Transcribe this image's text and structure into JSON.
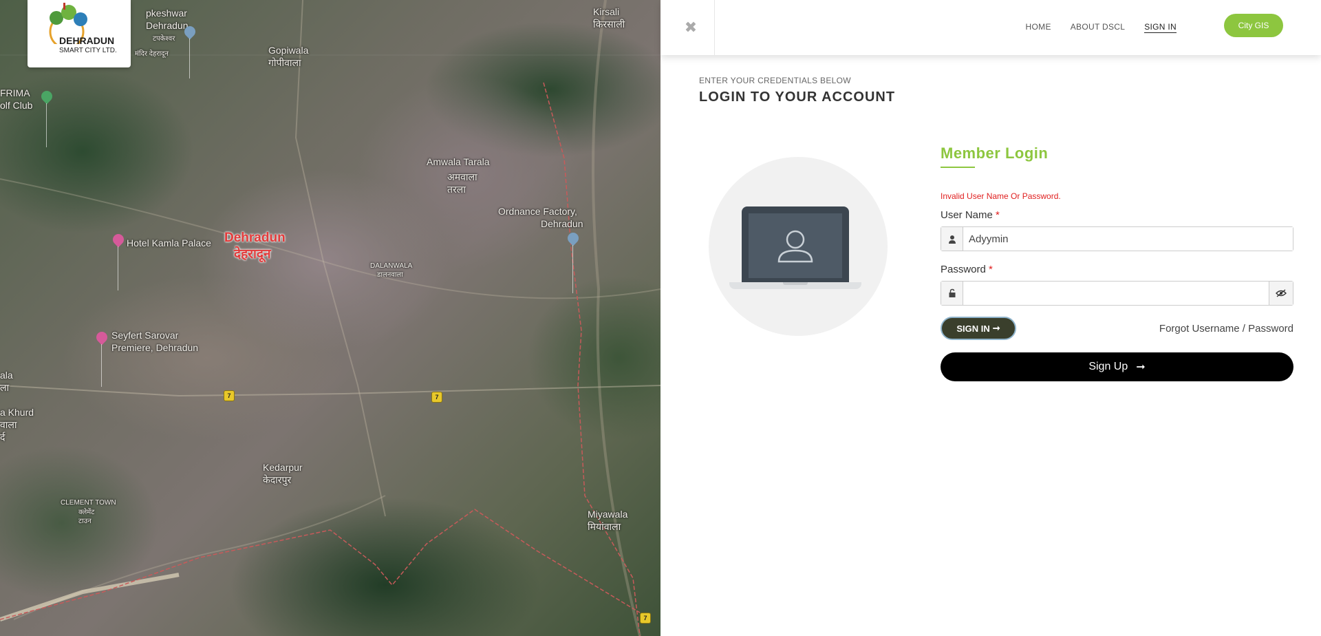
{
  "map": {
    "labels": {
      "kapkeshwar": "pkeshwar",
      "kapkeshwar2": "Dehradun",
      "kapkeshwar_hi": "टपकेश्वर",
      "kapkeshwar_hi2": "मंदिर देहरादून",
      "gopiwala": "Gopiwala",
      "gopiwala_hi": "गोपीवाला",
      "kirsali": "Kirsali",
      "kirsali_hi": "किरसाली",
      "frima": "FRIMA",
      "frima2": "olf Club",
      "amwala": "Amwala Tarala",
      "amwala_hi": "अमवाला",
      "amwala_hi2": "तरला",
      "ordnance": "Ordnance Factory,",
      "ordnance2": "Dehradun",
      "hotel": "Hotel Kamla Palace",
      "dehradun": "Dehradun",
      "dehradun_hi": "देहरादून",
      "dalanwala": "DALANWALA",
      "dalanwala_hi": "डालनवाला",
      "seyfert": "Seyfert Sarovar",
      "seyfert2": "Premiere, Dehradun",
      "ala": "ala",
      "ala_hi": "ला",
      "khurd": "a Khurd",
      "khurd_hi": "वाला",
      "khurd_hi2": "र्द",
      "kedarpur": "Kedarpur",
      "kedarpur_hi": "केदारपुर",
      "clement": "CLEMENT TOWN",
      "clement_hi": "क्लेमेंट",
      "clement_hi2": "टाउन",
      "miyawala": "Miyawala",
      "miyawala_hi": "मियांवाला"
    },
    "highway": "7"
  },
  "logo": {
    "title": "DEHRADUN",
    "subtitle": "SMART CITY LTD."
  },
  "nav": {
    "close_icon": "✖",
    "items": [
      {
        "label": "HOME"
      },
      {
        "label": "ABOUT DSCL"
      },
      {
        "label": "SIGN IN"
      }
    ],
    "city_gis": "City GIS"
  },
  "header": {
    "subtitle": "ENTER YOUR CREDENTIALS BELOW",
    "title": "LOGIN TO YOUR ACCOUNT"
  },
  "form": {
    "title": "Member Login",
    "error": "Invalid User Name Or Password.",
    "username_label": "User Name",
    "username_value": "Adyymin",
    "password_label": "Password",
    "password_value": "",
    "required_mark": "*",
    "signin_label": "SIGN IN",
    "signin_arrow": "➞",
    "forgot_label": "Forgot Username / Password",
    "signup_label": "Sign Up",
    "signup_arrow": "➞"
  },
  "colors": {
    "accent_green": "#8dc63f",
    "error_red": "#e01e1e",
    "signin_dark": "#3a3f2c"
  }
}
